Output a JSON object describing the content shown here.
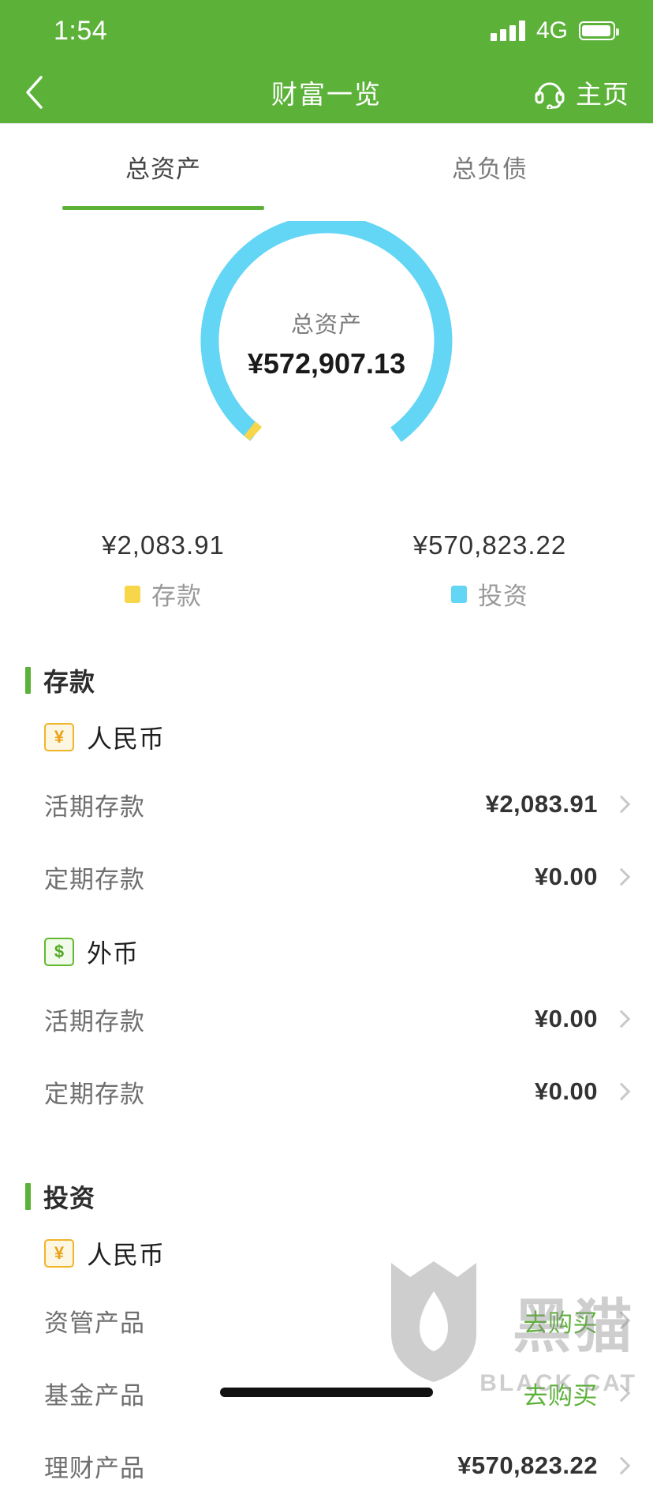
{
  "status_bar": {
    "time": "1:54",
    "network": "4G",
    "signal_icon": "signal-bars-icon",
    "battery_icon": "battery-icon"
  },
  "nav": {
    "back_icon": "chevron-left-icon",
    "title": "财富一览",
    "headset_icon": "headset-icon",
    "home_label": "主页"
  },
  "tabs": [
    {
      "label": "总资产",
      "active": true
    },
    {
      "label": "总负债",
      "active": false
    }
  ],
  "chart_center": {
    "label": "总资产",
    "value": "¥572,907.13"
  },
  "legend": [
    {
      "value": "¥2,083.91",
      "name": "存款",
      "color": "#f7d64a"
    },
    {
      "value": "¥570,823.22",
      "name": "投资",
      "color": "#63d5f5"
    }
  ],
  "chart_data": {
    "type": "pie",
    "title": "总资产",
    "center_label": "总资产",
    "center_value": 572907.13,
    "center_value_text": "¥572,907.13",
    "categories": [
      "存款",
      "投资"
    ],
    "values": [
      2083.91,
      570823.22
    ],
    "value_texts": [
      "¥2,083.91",
      "¥570,823.22"
    ],
    "colors": [
      "#f7d64a",
      "#63d5f5"
    ],
    "percentages": [
      0.36,
      99.64
    ],
    "donut": true,
    "legend_position": "bottom",
    "grid": false
  },
  "sections": [
    {
      "title": "存款",
      "groups": [
        {
          "currency": "人民币",
          "icon": "rmb-note-icon",
          "icon_glyph": "¥",
          "icon_style": "rmb",
          "rows": [
            {
              "label": "活期存款",
              "value": "¥2,083.91",
              "is_link": false
            },
            {
              "label": "定期存款",
              "value": "¥0.00",
              "is_link": false
            }
          ]
        },
        {
          "currency": "外币",
          "icon": "foreign-currency-icon",
          "icon_glyph": "$",
          "icon_style": "fx",
          "rows": [
            {
              "label": "活期存款",
              "value": "¥0.00",
              "is_link": false
            },
            {
              "label": "定期存款",
              "value": "¥0.00",
              "is_link": false
            }
          ]
        }
      ]
    },
    {
      "title": "投资",
      "groups": [
        {
          "currency": "人民币",
          "icon": "rmb-note-icon",
          "icon_glyph": "¥",
          "icon_style": "rmb",
          "rows": [
            {
              "label": "资管产品",
              "value": "去购买",
              "is_link": true
            },
            {
              "label": "基金产品",
              "value": "去购买",
              "is_link": true
            },
            {
              "label": "理财产品",
              "value": "¥570,823.22",
              "is_link": false
            }
          ]
        }
      ]
    }
  ],
  "watermark": {
    "cn": "黑猫",
    "en": "BLACK CAT"
  },
  "colors": {
    "brand_green": "#5cb239",
    "deposit_yellow": "#f7d64a",
    "invest_blue": "#63d5f5",
    "link_green": "#5cb239"
  }
}
